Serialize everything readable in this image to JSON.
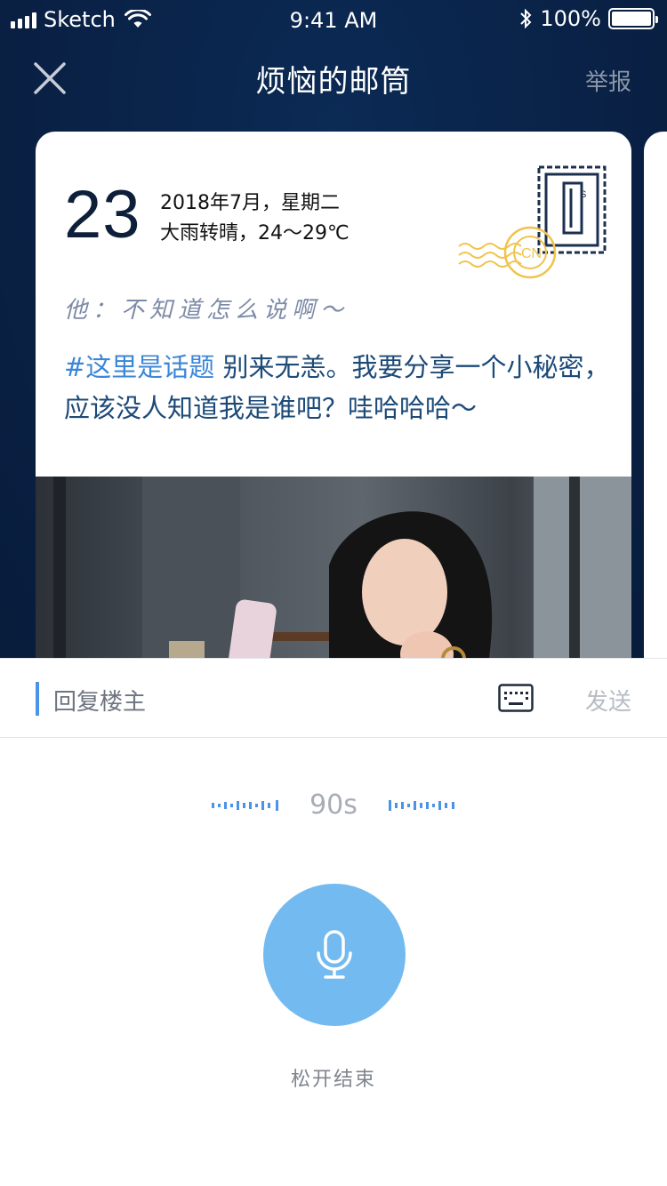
{
  "status_bar": {
    "carrier": "Sketch",
    "time": "9:41 AM",
    "battery": "100%"
  },
  "nav": {
    "title": "烦恼的邮筒",
    "report_label": "举报",
    "close_icon": "close-icon"
  },
  "card": {
    "day": "23",
    "date_line": "2018年7月，星期二",
    "weather_line": "大雨转晴，24～29℃",
    "stamp_letter": "S",
    "postmark_text": "CN",
    "handwriting": "他：不知道怎么说啊～",
    "post_tag": "#这里是话题",
    "post_body": " 别来无恙。我要分享一个小秘密，应该没人知道我是谁吧？哇哈哈哈～"
  },
  "reply": {
    "placeholder": "回复楼主",
    "send_label": "发送",
    "keyboard_icon": "keyboard-icon"
  },
  "voice": {
    "duration": "90s",
    "mic_icon": "microphone-icon",
    "release_label": "松开结束"
  },
  "colors": {
    "accent": "#4b93e6",
    "mic_bg": "#72baf0",
    "nav_bg": "#0a2349"
  }
}
